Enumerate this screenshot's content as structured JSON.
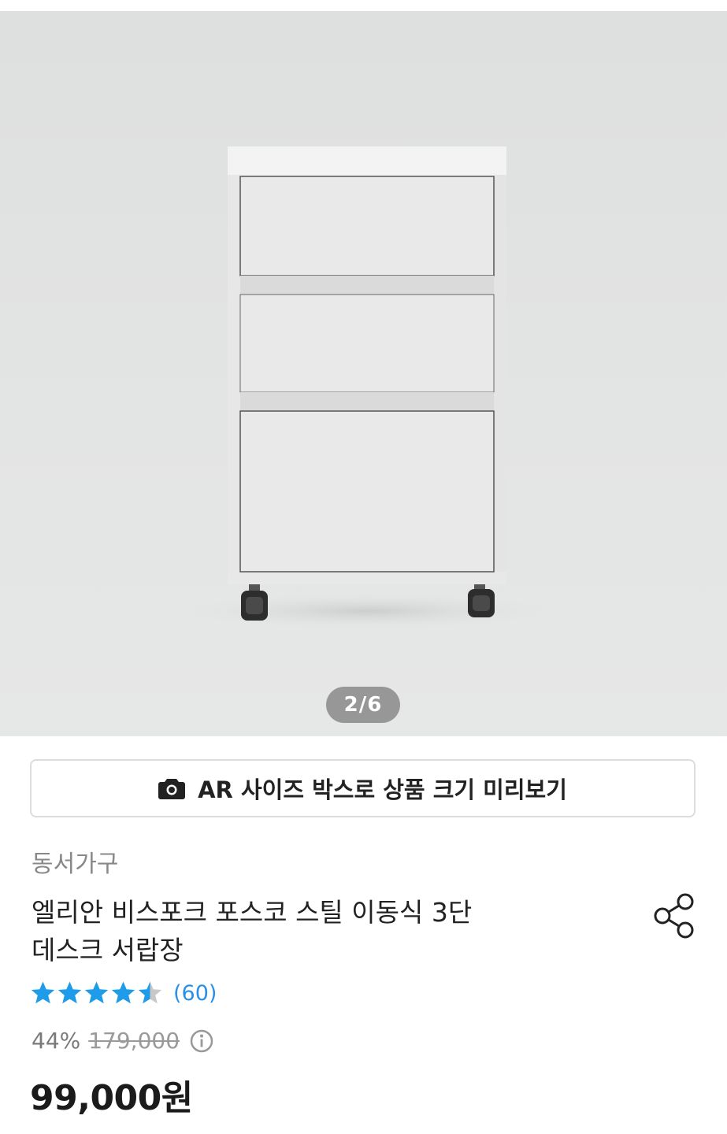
{
  "gallery": {
    "counter": "2/6",
    "image_subject": "white three-drawer mobile desk cabinet"
  },
  "ar_button": {
    "label": "AR 사이즈 박스로 상품 크기 미리보기",
    "icon": "camera-icon"
  },
  "product": {
    "brand": "동서가구",
    "title_line1": "엘리안 비스포크 포스코 스틸 이동식 3단",
    "title_line2": "데스크 서랍장",
    "rating": 4.5,
    "rating_max": 5,
    "review_count": "(60)",
    "discount": "44%",
    "original_price": "179,000",
    "sale_price": "99,000원"
  },
  "icons": {
    "share": "share-icon",
    "info": "info-icon",
    "star": "star-icon"
  },
  "colors": {
    "star_filled": "#1e9be9",
    "star_empty": "#c8c8c8",
    "review_link": "#2a8fe6",
    "price_text": "#1b1b1b"
  }
}
